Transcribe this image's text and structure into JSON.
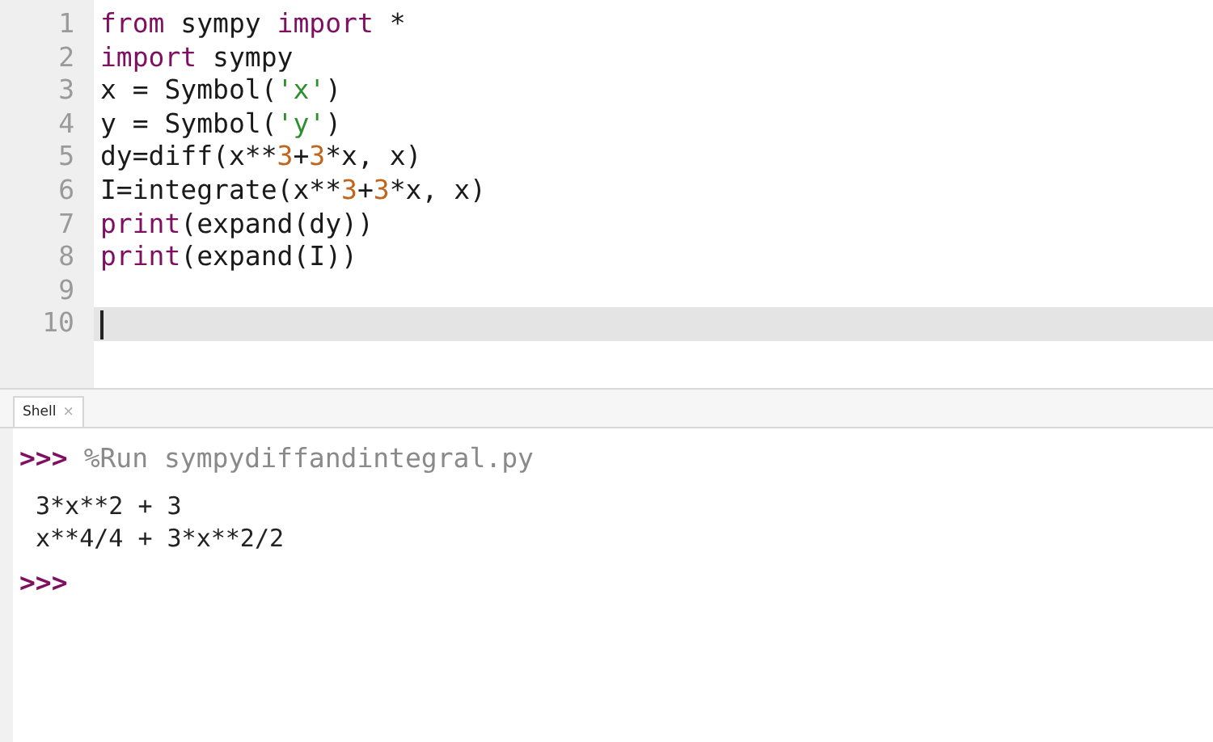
{
  "editor": {
    "lines": [
      {
        "number": "1",
        "current": false,
        "tokens": [
          {
            "kind": "keyword",
            "text": "from"
          },
          {
            "kind": "plain",
            "text": " sympy "
          },
          {
            "kind": "keyword",
            "text": "import"
          },
          {
            "kind": "plain",
            "text": " *"
          }
        ]
      },
      {
        "number": "2",
        "current": false,
        "tokens": [
          {
            "kind": "keyword",
            "text": "import"
          },
          {
            "kind": "plain",
            "text": " sympy"
          }
        ]
      },
      {
        "number": "3",
        "current": false,
        "tokens": [
          {
            "kind": "plain",
            "text": "x = Symbol("
          },
          {
            "kind": "string",
            "text": "'x'"
          },
          {
            "kind": "plain",
            "text": ")"
          }
        ]
      },
      {
        "number": "4",
        "current": false,
        "tokens": [
          {
            "kind": "plain",
            "text": "y = Symbol("
          },
          {
            "kind": "string",
            "text": "'y'"
          },
          {
            "kind": "plain",
            "text": ")"
          }
        ]
      },
      {
        "number": "5",
        "current": false,
        "tokens": [
          {
            "kind": "plain",
            "text": "dy=diff(x**"
          },
          {
            "kind": "number",
            "text": "3"
          },
          {
            "kind": "plain",
            "text": "+"
          },
          {
            "kind": "number",
            "text": "3"
          },
          {
            "kind": "plain",
            "text": "*x, x)"
          }
        ]
      },
      {
        "number": "6",
        "current": false,
        "tokens": [
          {
            "kind": "plain",
            "text": "I=integrate(x**"
          },
          {
            "kind": "number",
            "text": "3"
          },
          {
            "kind": "plain",
            "text": "+"
          },
          {
            "kind": "number",
            "text": "3"
          },
          {
            "kind": "plain",
            "text": "*x, x)"
          }
        ]
      },
      {
        "number": "7",
        "current": false,
        "tokens": [
          {
            "kind": "keyword",
            "text": "print"
          },
          {
            "kind": "plain",
            "text": "(expand(dy))"
          }
        ]
      },
      {
        "number": "8",
        "current": false,
        "tokens": [
          {
            "kind": "keyword",
            "text": "print"
          },
          {
            "kind": "plain",
            "text": "(expand(I))"
          }
        ]
      },
      {
        "number": "9",
        "current": false
      },
      {
        "number": "10",
        "current": true
      }
    ]
  },
  "shell": {
    "tab": {
      "label": "Shell",
      "close": "×",
      "selected": true
    },
    "entries": [
      {
        "kind": "command",
        "prompt": ">>>",
        "text": "%Run sympydiffandintegral.py"
      },
      {
        "kind": "output",
        "text": "3*x**2 + 3"
      },
      {
        "kind": "output",
        "text": "x**4/4 + 3*x**2/2"
      },
      {
        "kind": "command",
        "prompt": ">>>"
      }
    ]
  }
}
